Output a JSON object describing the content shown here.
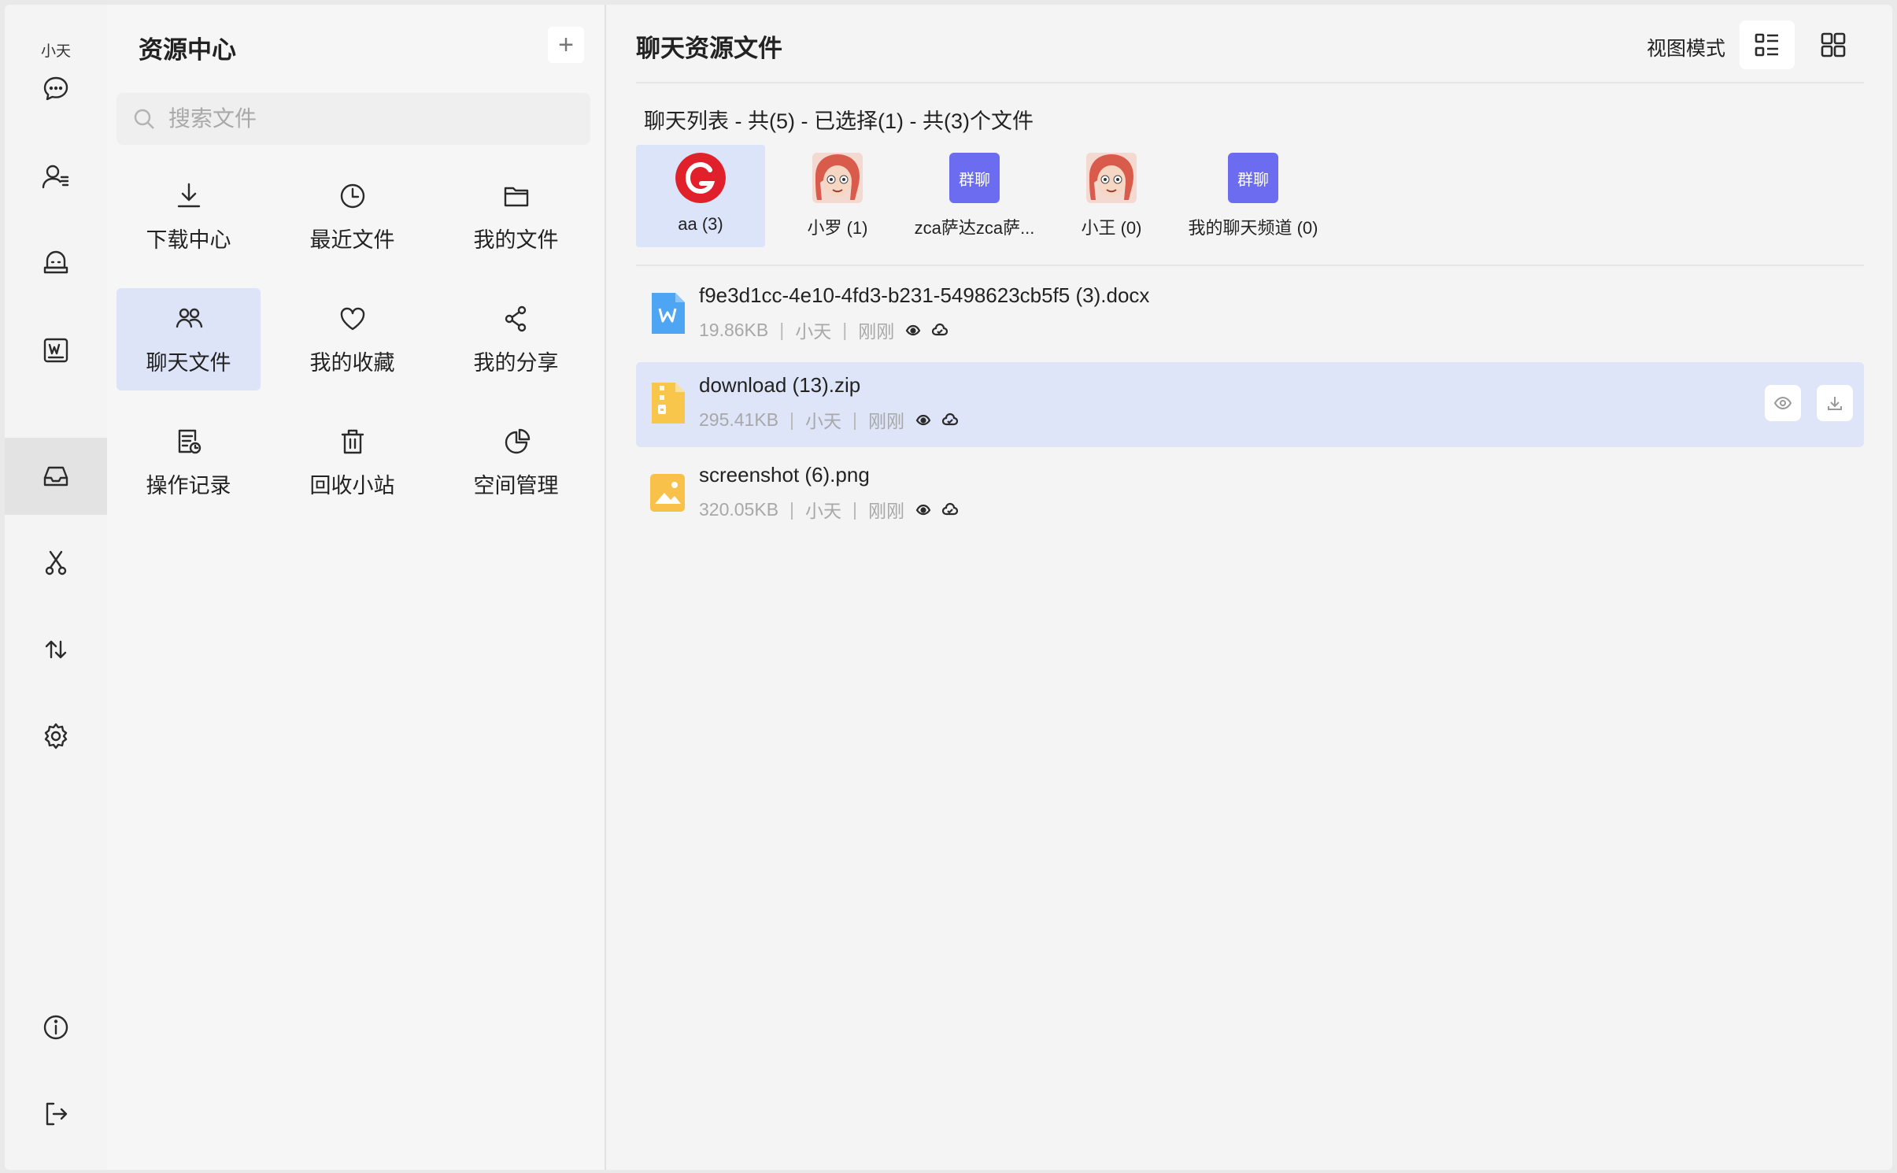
{
  "rail": {
    "user": "小天",
    "items": [
      {
        "icon": "chat-bubble-icon"
      },
      {
        "icon": "contacts-icon"
      },
      {
        "icon": "robot-icon"
      },
      {
        "icon": "word-doc-icon"
      },
      {
        "icon": "inbox-icon",
        "active": true
      },
      {
        "icon": "scissors-icon"
      },
      {
        "icon": "transfer-arrows-icon"
      },
      {
        "icon": "settings-gear-icon"
      }
    ],
    "bottom": [
      {
        "icon": "info-icon"
      },
      {
        "icon": "logout-icon"
      }
    ]
  },
  "panel": {
    "title": "资源中心",
    "add_icon": "plus-icon",
    "add_label": "+",
    "search_placeholder": "搜索文件",
    "tiles": [
      {
        "label": "下载中心",
        "icon": "download-icon"
      },
      {
        "label": "最近文件",
        "icon": "clock-icon"
      },
      {
        "label": "我的文件",
        "icon": "folder-icon"
      },
      {
        "label": "聊天文件",
        "icon": "group-chat-icon",
        "active": true
      },
      {
        "label": "我的收藏",
        "icon": "heart-icon"
      },
      {
        "label": "我的分享",
        "icon": "share-icon"
      },
      {
        "label": "操作记录",
        "icon": "history-doc-icon"
      },
      {
        "label": "回收小站",
        "icon": "trash-icon"
      },
      {
        "label": "空间管理",
        "icon": "pie-chart-icon"
      }
    ]
  },
  "main": {
    "title": "聊天资源文件",
    "view_mode_label": "视图模式",
    "view_buttons": [
      {
        "icon": "list-view-icon",
        "active": true
      },
      {
        "icon": "grid-view-icon"
      }
    ],
    "summary": "聊天列表 - 共(5) - 已选择(1) - 共(3)个文件",
    "chats": [
      {
        "name": "aa (3)",
        "avatar": "logo-avatar",
        "active": true
      },
      {
        "name": "小罗 (1)",
        "avatar": "cartoon-avatar"
      },
      {
        "name": "zca萨达zca萨...",
        "avatar": "group",
        "avatar_text": "群聊"
      },
      {
        "name": "小王 (0)",
        "avatar": "cartoon-avatar"
      },
      {
        "name": "我的聊天频道 (0)",
        "avatar": "group",
        "avatar_text": "群聊"
      }
    ],
    "files": [
      {
        "name": "f9e3d1cc-4e10-4fd3-b231-5498623cb5f5 (3).docx",
        "size": "19.86KB",
        "owner": "小天",
        "time": "刚刚",
        "type": "docx-file-icon",
        "color": "#4ea5f4"
      },
      {
        "name": "download (13).zip",
        "size": "295.41KB",
        "owner": "小天",
        "time": "刚刚",
        "type": "zip-file-icon",
        "color": "#f7c64a",
        "active": true
      },
      {
        "name": "screenshot (6).png",
        "size": "320.05KB",
        "owner": "小天",
        "time": "刚刚",
        "type": "image-file-icon",
        "color": "#f8c24a"
      }
    ],
    "separator": "|"
  }
}
